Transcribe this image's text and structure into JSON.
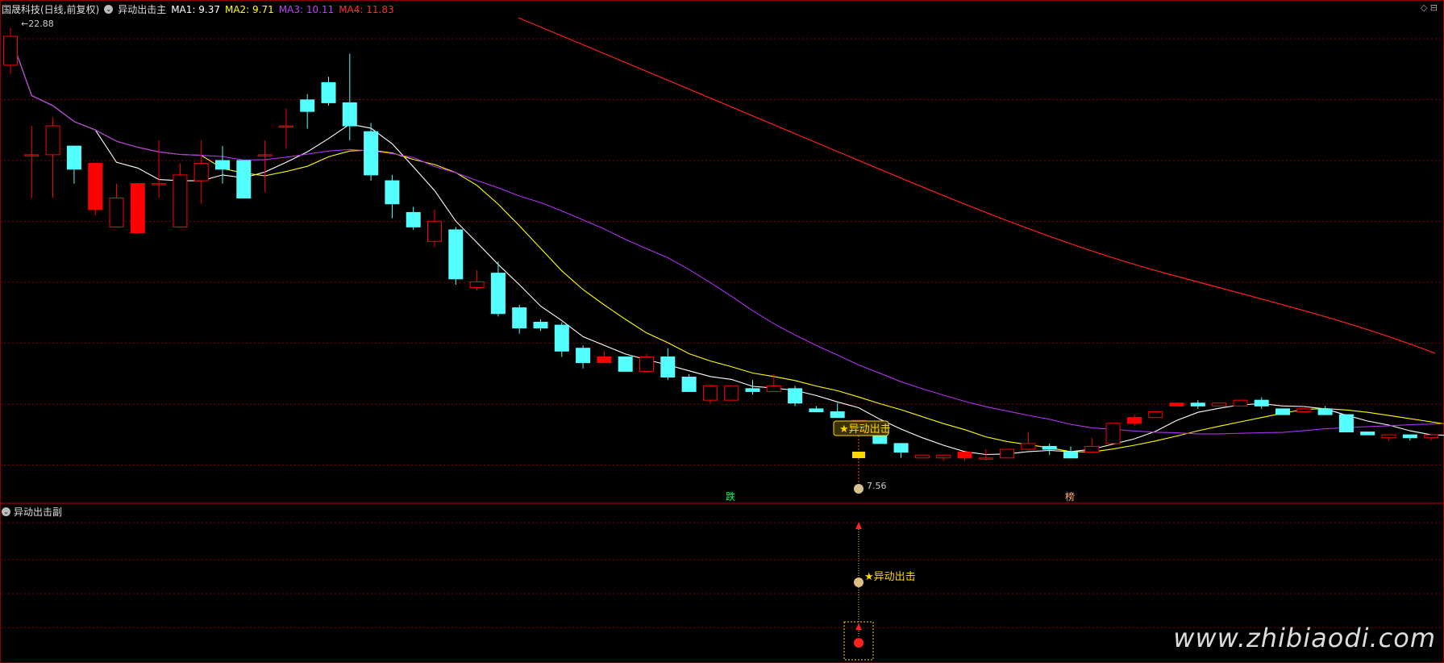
{
  "header": {
    "symbol": "国晟科技(日线,前复权)",
    "indicator": "异动出击主",
    "ma": [
      {
        "label": "MA1: 9.37",
        "color": "#ffffff"
      },
      {
        "label": "MA2: 9.71",
        "color": "#ffff00"
      },
      {
        "label": "MA3: 10.11",
        "color": "#c040ff"
      },
      {
        "label": "MA4: 11.83",
        "color": "#ff3030"
      }
    ],
    "corner_icons": "◇ ⊟"
  },
  "sub_panel": {
    "title": "异动出击副"
  },
  "labels": {
    "high_price": "22.88",
    "low_price": "7.56",
    "signal_main": "★异动出击",
    "signal_sub": "★异动出击",
    "mark_die": "跌",
    "mark_bang": "榜"
  },
  "watermark": "www.zhibiaodi.com",
  "colors": {
    "up": "#ff0000",
    "down": "#54ffff",
    "grid": "#8b0000"
  },
  "chart_data": {
    "type": "candlestick",
    "candles": [
      [
        21.6,
        22.6,
        22.9,
        21.3
      ],
      [
        18.5,
        18.5,
        19.5,
        17.0
      ],
      [
        18.5,
        19.5,
        19.8,
        17.0
      ],
      [
        18.8,
        18.0,
        18.8,
        17.5
      ],
      [
        16.6,
        18.2,
        18.2,
        16.4
      ],
      [
        16.0,
        17.0,
        17.5,
        16.0
      ],
      [
        15.8,
        17.5,
        17.5,
        15.8
      ],
      [
        17.5,
        17.5,
        19.0,
        17.0
      ],
      [
        16.0,
        17.8,
        18.2,
        16.6
      ],
      [
        17.6,
        18.2,
        19.0,
        16.8
      ],
      [
        18.3,
        18.0,
        18.8,
        17.5
      ],
      [
        18.3,
        17.0,
        18.3,
        17.0
      ],
      [
        18.5,
        18.5,
        19.0,
        17.2
      ],
      [
        19.5,
        19.5,
        20.1,
        18.7
      ],
      [
        20.4,
        20.0,
        20.6,
        19.4
      ],
      [
        21.0,
        20.3,
        21.2,
        20.2
      ],
      [
        20.3,
        19.5,
        22.0,
        19.0
      ],
      [
        19.3,
        17.8,
        19.6,
        17.6
      ],
      [
        17.6,
        16.8,
        17.8,
        16.3
      ],
      [
        16.5,
        16.0,
        16.7,
        15.9
      ],
      [
        15.5,
        16.2,
        16.6,
        15.3
      ],
      [
        15.9,
        14.2,
        16.0,
        14.0
      ],
      [
        13.9,
        14.1,
        14.5,
        13.8
      ],
      [
        14.4,
        13.0,
        14.8,
        12.9
      ],
      [
        13.2,
        12.5,
        13.3,
        12.3
      ],
      [
        12.7,
        12.5,
        12.8,
        12.4
      ],
      [
        12.6,
        11.7,
        12.7,
        11.5
      ],
      [
        11.8,
        11.3,
        11.9,
        11.1
      ],
      [
        11.3,
        11.5,
        11.7,
        11.3
      ],
      [
        11.5,
        11.0,
        11.5,
        11.0
      ],
      [
        11.0,
        11.5,
        11.6,
        11.0
      ],
      [
        11.5,
        10.8,
        11.8,
        10.7
      ],
      [
        10.8,
        10.3,
        10.9,
        10.3
      ],
      [
        10.0,
        10.5,
        10.5,
        9.9
      ],
      [
        10.0,
        10.5,
        10.5,
        10.0
      ],
      [
        10.4,
        10.3,
        10.7,
        10.2
      ],
      [
        10.3,
        10.5,
        10.9,
        10.3
      ],
      [
        10.4,
        9.9,
        10.5,
        9.8
      ],
      [
        9.7,
        9.6,
        9.8,
        9.6
      ],
      [
        9.6,
        9.4,
        9.9,
        9.4
      ],
      [
        9.2,
        9.3,
        9.3,
        9.1
      ],
      [
        9.1,
        8.5,
        9.1,
        8.5
      ],
      [
        8.5,
        8.2,
        8.5,
        8.0
      ],
      [
        8.0,
        8.1,
        8.1,
        8.0
      ],
      [
        8.0,
        8.1,
        8.1,
        7.9
      ],
      [
        8.0,
        8.2,
        8.2,
        7.9
      ],
      [
        8.0,
        8.0,
        8.3,
        7.9
      ],
      [
        8.0,
        8.3,
        8.3,
        8.0
      ],
      [
        8.3,
        8.5,
        8.9,
        8.3
      ],
      [
        8.4,
        8.3,
        8.5,
        8.1
      ],
      [
        8.2,
        8.0,
        8.4,
        8.0
      ],
      [
        8.2,
        8.4,
        8.7,
        8.2
      ],
      [
        8.5,
        9.2,
        9.2,
        8.5
      ],
      [
        9.2,
        9.4,
        9.5,
        9.1
      ],
      [
        9.4,
        9.6,
        9.6,
        9.4
      ],
      [
        9.8,
        9.9,
        9.9,
        9.8
      ],
      [
        9.9,
        9.8,
        10.0,
        9.7
      ],
      [
        9.8,
        9.9,
        9.9,
        9.8
      ],
      [
        9.8,
        10.0,
        10.0,
        9.8
      ],
      [
        10.0,
        9.8,
        10.1,
        9.7
      ],
      [
        9.7,
        9.5,
        9.7,
        9.5
      ],
      [
        9.6,
        9.7,
        9.7,
        9.6
      ],
      [
        9.7,
        9.5,
        9.8,
        9.5
      ],
      [
        9.5,
        8.9,
        9.5,
        8.9
      ],
      [
        8.9,
        8.8,
        8.9,
        8.8
      ],
      [
        8.7,
        8.8,
        8.8,
        8.6
      ],
      [
        8.8,
        8.7,
        8.8,
        8.6
      ],
      [
        8.7,
        8.8,
        8.8,
        8.6
      ],
      [
        8.7,
        8.8,
        8.9,
        8.7
      ],
      [
        8.8,
        8.8,
        8.8,
        8.7
      ]
    ],
    "ylim": [
      7.1,
      23.3
    ]
  }
}
